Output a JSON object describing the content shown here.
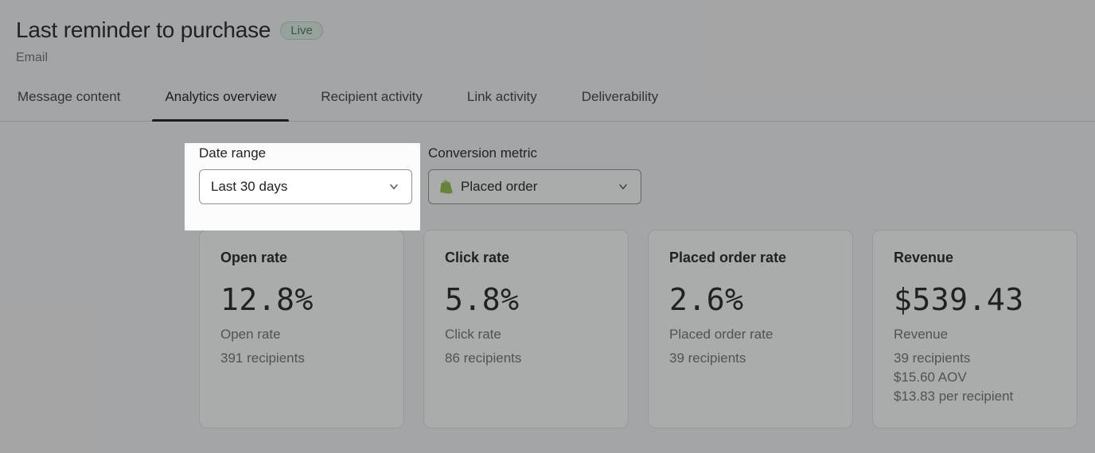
{
  "header": {
    "title": "Last reminder to purchase",
    "badge": "Live",
    "subtitle": "Email"
  },
  "tabs": [
    {
      "label": "Message content",
      "active": false
    },
    {
      "label": "Analytics overview",
      "active": true
    },
    {
      "label": "Recipient activity",
      "active": false
    },
    {
      "label": "Link activity",
      "active": false
    },
    {
      "label": "Deliverability",
      "active": false
    }
  ],
  "filters": {
    "date_range": {
      "label": "Date range",
      "value": "Last 30 days"
    },
    "conversion_metric": {
      "label": "Conversion metric",
      "value": "Placed order"
    }
  },
  "cards": [
    {
      "title": "Open rate",
      "value": "12.8%",
      "sub": "Open rate",
      "lines": [
        "391 recipients"
      ]
    },
    {
      "title": "Click rate",
      "value": "5.8%",
      "sub": "Click rate",
      "lines": [
        "86 recipients"
      ]
    },
    {
      "title": "Placed order rate",
      "value": "2.6%",
      "sub": "Placed order rate",
      "lines": [
        "39 recipients"
      ]
    },
    {
      "title": "Revenue",
      "value": "$539.43",
      "sub": "Revenue",
      "lines": [
        "39 recipients",
        "$15.60 AOV",
        "$13.83 per recipient"
      ]
    }
  ]
}
